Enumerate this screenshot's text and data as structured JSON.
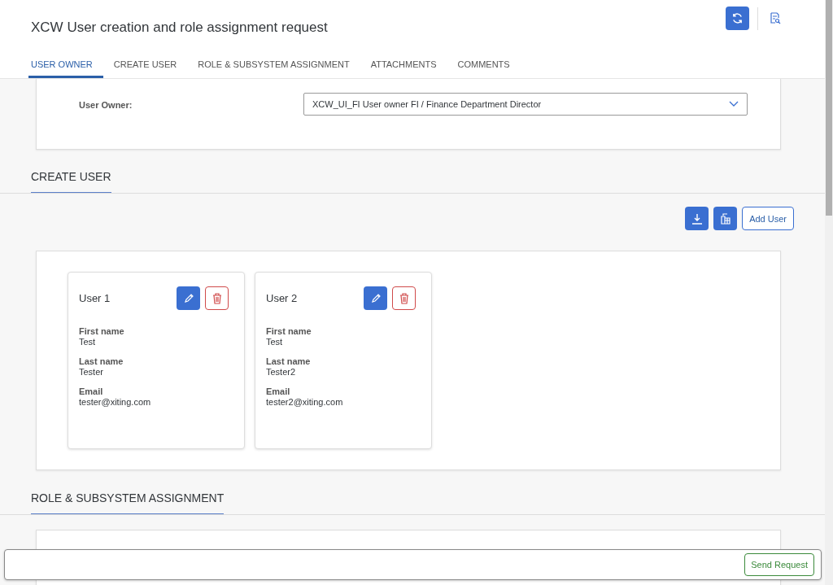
{
  "header": {
    "title": "XCW User creation and role assignment request"
  },
  "tabs": [
    {
      "label": "USER OWNER",
      "selected": true
    },
    {
      "label": "CREATE USER",
      "selected": false
    },
    {
      "label": "ROLE & SUBSYSTEM ASSIGNMENT",
      "selected": false
    },
    {
      "label": "ATTACHMENTS",
      "selected": false
    },
    {
      "label": "COMMENTS",
      "selected": false
    }
  ],
  "user_owner": {
    "label": "User Owner:",
    "value": "XCW_UI_FI User owner FI / Finance Department Director"
  },
  "create_user": {
    "heading": "CREATE USER",
    "add_button": "Add User",
    "users": [
      {
        "title": "User 1",
        "fields": [
          {
            "label": "First name",
            "value": "Test"
          },
          {
            "label": "Last name",
            "value": "Tester"
          },
          {
            "label": "Email",
            "value": "tester@xiting.com"
          }
        ]
      },
      {
        "title": "User 2",
        "fields": [
          {
            "label": "First name",
            "value": "Test"
          },
          {
            "label": "Last name",
            "value": "Tester2"
          },
          {
            "label": "Email",
            "value": "tester2@xiting.com"
          }
        ]
      }
    ]
  },
  "role_assignment": {
    "heading": "ROLE & SUBSYSTEM ASSIGNMENT"
  },
  "footer": {
    "send_button": "Send Request"
  }
}
